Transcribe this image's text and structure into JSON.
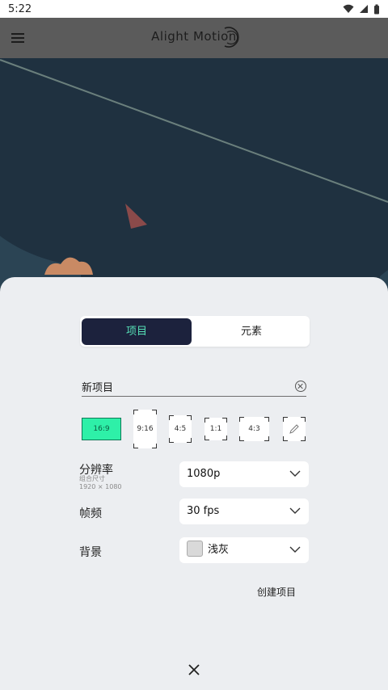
{
  "statusbar": {
    "time": "5:22"
  },
  "appbar": {
    "title": "Alight Motion"
  },
  "tabs": {
    "project": "项目",
    "element": "元素"
  },
  "project_name": {
    "value": "新项目"
  },
  "ratios": [
    "16:9",
    "9:16",
    "4:5",
    "1:1",
    "4:3"
  ],
  "settings": {
    "resolution_label": "分辨率",
    "resolution_sub1": "组合尺寸",
    "resolution_sub2": "1920 × 1080",
    "resolution_value": "1080p",
    "fps_label": "帧频",
    "fps_value": "30 fps",
    "background_label": "背景",
    "background_value": "浅灰",
    "background_color": "#d9d9d9"
  },
  "create_button": "创建项目",
  "colors": {
    "accent": "#2ef0a8",
    "tab_active_bg": "#1c223d",
    "tab_active_text": "#56e0b6",
    "canvas_bg": "#1f3140",
    "sheet_bg": "#eceef1"
  }
}
